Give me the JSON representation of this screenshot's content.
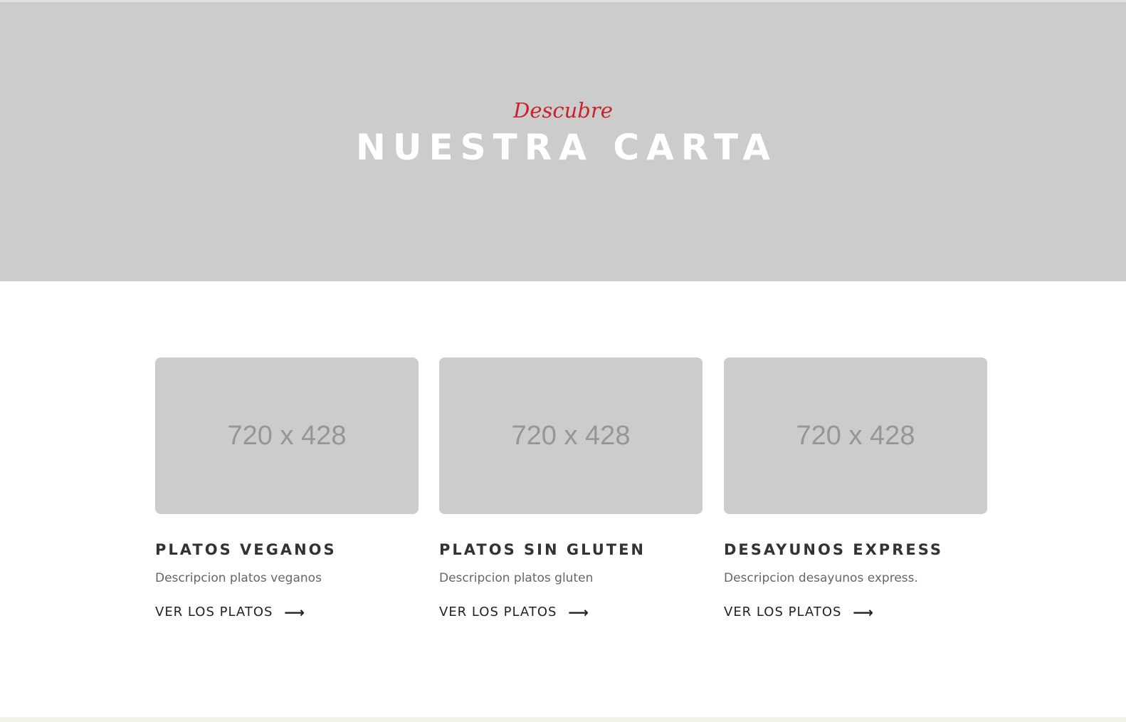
{
  "hero": {
    "kicker": "Descubre",
    "title": "NUESTRA CARTA"
  },
  "cards": [
    {
      "image_placeholder": "720 x 428",
      "title": "PLATOS VEGANOS",
      "description": "Descripcion platos veganos",
      "link_label": "VER LOS PLATOS",
      "link_icon": "arrow-right-icon"
    },
    {
      "image_placeholder": "720 x 428",
      "title": "PLATOS SIN GLUTEN",
      "description": "Descripcion platos gluten",
      "link_label": "VER LOS PLATOS",
      "link_icon": "arrow-right-icon"
    },
    {
      "image_placeholder": "720 x 428",
      "title": "DESAYUNOS EXPRESS",
      "description": "Descripcion desayunos express.",
      "link_label": "VER LOS PLATOS",
      "link_icon": "arrow-right-icon"
    }
  ],
  "colors": {
    "accent": "#c8232c",
    "hero_background": "#cccccc",
    "placeholder_text": "#969696",
    "heading_text": "#333333"
  }
}
